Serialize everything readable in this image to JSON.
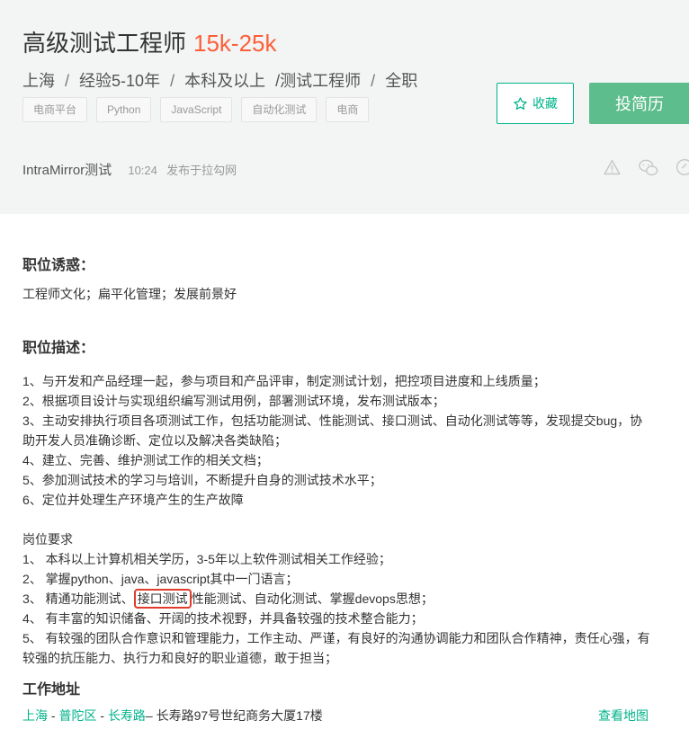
{
  "job": {
    "title": "高级测试工程师",
    "salary": "15k-25k",
    "city": "上海",
    "experience": "经验5-10年",
    "education": "本科及以上",
    "category": "/测试工程师",
    "type": "全职",
    "separator": "/",
    "tags": [
      "电商平台",
      "Python",
      "JavaScript",
      "自动化测试",
      "电商"
    ]
  },
  "actions": {
    "collect_label": "收藏",
    "apply_label": "投简历"
  },
  "publisher": {
    "company": "IntraMirror测试",
    "time": "10:24",
    "published_on": "发布于拉勾网"
  },
  "icons": {
    "collect": "star-icon",
    "report": "warning-icon",
    "share_wechat": "wechat-icon",
    "share_link": "link-icon"
  },
  "sections": {
    "perks_title": "职位诱惑：",
    "perks_text": "工程师文化；扁平化管理；发展前景好",
    "description_title": "职位描述：",
    "duties": [
      "1、与开发和产品经理一起，参与项目和产品评审，制定测试计划，把控项目进度和上线质量；",
      "2、根据项目设计与实现组织编写测试用例，部署测试环境，发布测试版本；",
      "3、主动安排执行项目各项测试工作，包括功能测试、性能测试、接口测试、自动化测试等等，发现提交bug，协助开发人员准确诊断、定位以及解决各类缺陷；",
      "4、建立、完善、维护测试工作的相关文档；",
      "5、参加测试技术的学习与培训，不断提升自身的测试技术水平；",
      "6、定位并处理生产环境产生的生产故障"
    ],
    "requirements_title": "岗位要求",
    "requirements": [
      "1、 本科以上计算机相关学历，3-5年以上软件测试相关工作经验；",
      "2、 掌握python、java、javascript其中一门语言；",
      "4、 有丰富的知识储备、开阔的技术视野，并具备较强的技术整合能力；",
      "5、 有较强的团队合作意识和管理能力，工作主动、严谨，有良好的沟通协调能力和团队合作精神，责任心强，有较强的抗压能力、执行力和良好的职业道德，敢于担当；"
    ],
    "requirement3_prefix": "3、 精通功能测试、",
    "requirement3_highlight": "接口测试",
    "requirement3_suffix": "性能测试、自动化测试、掌握devops思想；"
  },
  "location": {
    "title": "工作地址",
    "city": "上海",
    "district": "普陀区",
    "street": "长寿路",
    "dash": " - ",
    "detail": "– 长寿路97号世纪商务大厦17楼",
    "map_link": "查看地图"
  }
}
